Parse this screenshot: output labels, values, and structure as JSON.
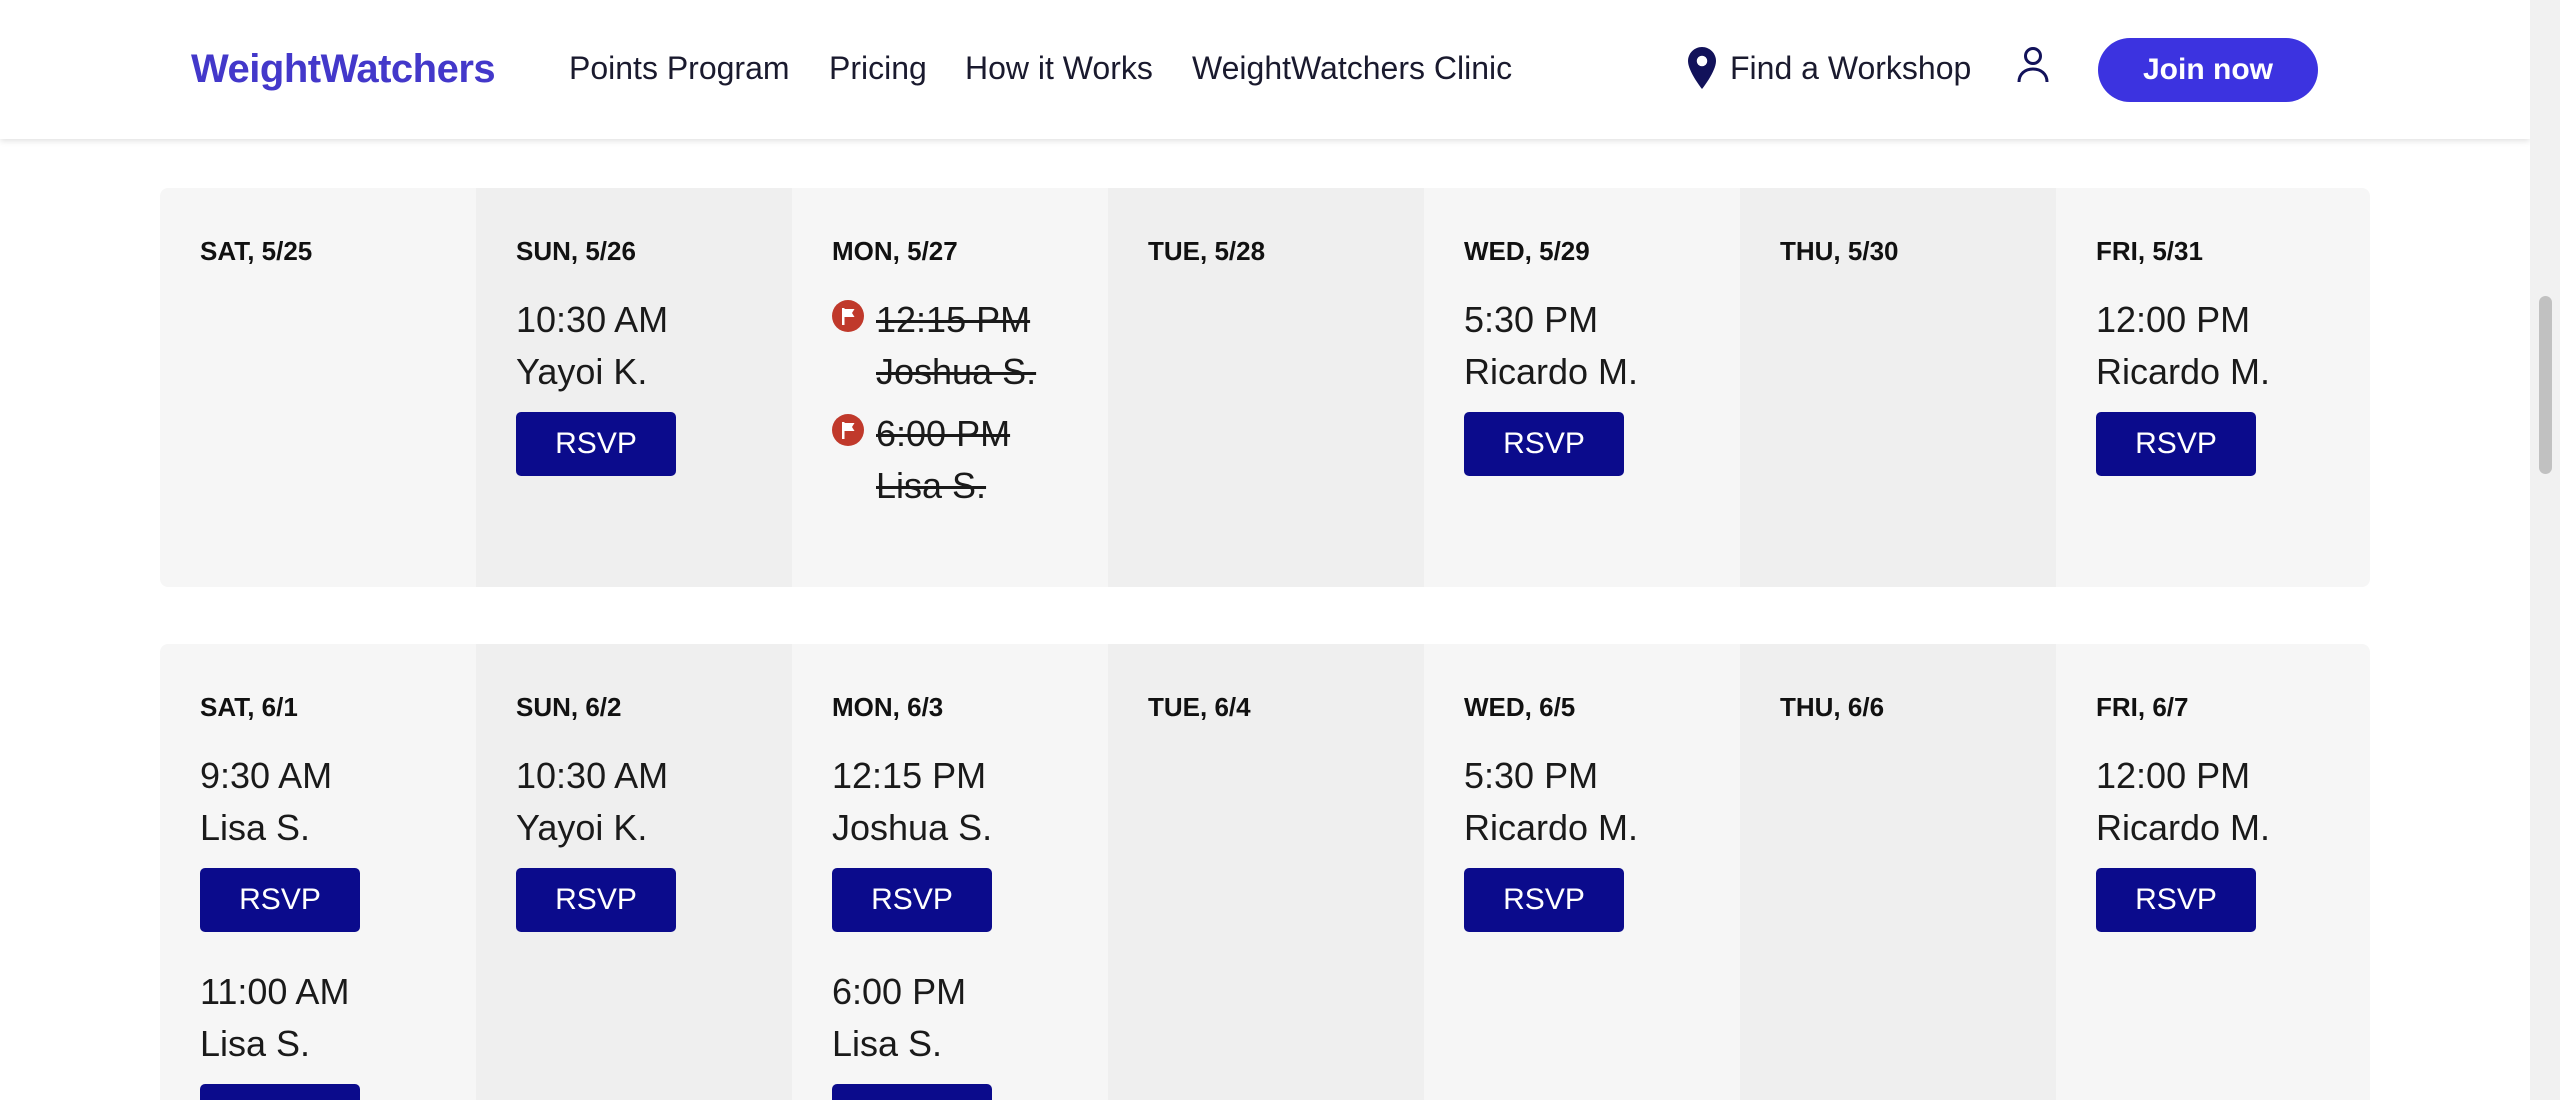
{
  "header": {
    "logo": "WeightWatchers",
    "nav": [
      {
        "label": "Points Program"
      },
      {
        "label": "Pricing"
      },
      {
        "label": "How it Works"
      },
      {
        "label": "WeightWatchers Clinic"
      }
    ],
    "find_workshop": "Find a Workshop",
    "join_label": "Join now",
    "icons": {
      "location": "map-pin-icon",
      "account": "user-icon"
    },
    "accent_color": "#3c33e0"
  },
  "weeks": [
    {
      "days": [
        {
          "label": "SAT, 5/25",
          "sessions": []
        },
        {
          "label": "SUN, 5/26",
          "sessions": [
            {
              "time": "10:30 AM",
              "coach": "Yayoi K.",
              "rsvp": "RSVP"
            }
          ]
        },
        {
          "label": "MON, 5/27",
          "sessions": [
            {
              "time": "12:15 PM",
              "coach": "Joshua S.",
              "status": "cancelled"
            },
            {
              "time": "6:00 PM",
              "coach": "Lisa S.",
              "status": "cancelled"
            }
          ]
        },
        {
          "label": "TUE, 5/28",
          "sessions": []
        },
        {
          "label": "WED, 5/29",
          "sessions": [
            {
              "time": "5:30 PM",
              "coach": "Ricardo M.",
              "rsvp": "RSVP"
            }
          ]
        },
        {
          "label": "THU, 5/30",
          "sessions": []
        },
        {
          "label": "FRI, 5/31",
          "sessions": [
            {
              "time": "12:00 PM",
              "coach": "Ricardo M.",
              "rsvp": "RSVP"
            }
          ]
        }
      ]
    },
    {
      "days": [
        {
          "label": "SAT, 6/1",
          "sessions": [
            {
              "time": "9:30 AM",
              "coach": "Lisa S.",
              "rsvp": "RSVP"
            },
            {
              "time": "11:00 AM",
              "coach": "Lisa S.",
              "rsvp": "RSVP"
            }
          ]
        },
        {
          "label": "SUN, 6/2",
          "sessions": [
            {
              "time": "10:30 AM",
              "coach": "Yayoi K.",
              "rsvp": "RSVP"
            }
          ]
        },
        {
          "label": "MON, 6/3",
          "sessions": [
            {
              "time": "12:15 PM",
              "coach": "Joshua S.",
              "rsvp": "RSVP"
            },
            {
              "time": "6:00 PM",
              "coach": "Lisa S.",
              "rsvp": "RSVP"
            }
          ]
        },
        {
          "label": "TUE, 6/4",
          "sessions": []
        },
        {
          "label": "WED, 6/5",
          "sessions": [
            {
              "time": "5:30 PM",
              "coach": "Ricardo M.",
              "rsvp": "RSVP"
            }
          ]
        },
        {
          "label": "THU, 6/6",
          "sessions": []
        },
        {
          "label": "FRI, 6/7",
          "sessions": [
            {
              "time": "12:00 PM",
              "coach": "Ricardo M.",
              "rsvp": "RSVP"
            }
          ]
        }
      ]
    }
  ],
  "colors": {
    "rsvp_button": "#0b0b8c",
    "cancelled_icon": "#c0392b",
    "logo": "#4338ca"
  }
}
